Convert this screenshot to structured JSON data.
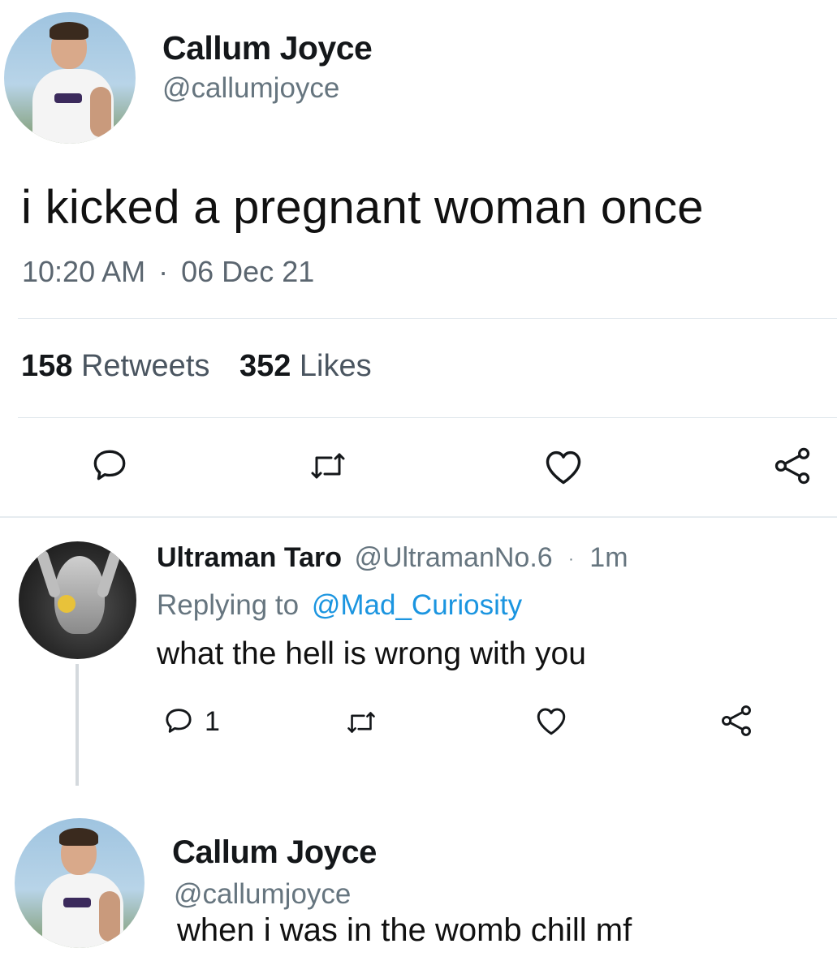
{
  "tweet": {
    "name": "Callum Joyce",
    "handle": "@callumjoyce",
    "text": "i kicked a pregnant woman once",
    "time": "10:20 AM",
    "separator": "·",
    "date": "06 Dec 21",
    "retweets_count": "158",
    "retweets_label": "Retweets",
    "likes_count": "352",
    "likes_label": "Likes"
  },
  "reply1": {
    "name": "Ultraman Taro",
    "handle": "@UltramanNo.6",
    "separator": "·",
    "age": "1m",
    "replying_label": "Replying to",
    "replying_to": "@Mad_Curiosity",
    "text": "what the hell is wrong with you",
    "reply_count": "1"
  },
  "reply2": {
    "name": "Callum Joyce",
    "handle": "@callumjoyce",
    "text": "when i was in the womb chill mf"
  },
  "colors": {
    "link": "#1b95e0",
    "text": "#14171a",
    "muted": "#66757f",
    "divider": "#e1e8ed"
  },
  "icons": [
    "reply-icon",
    "retweet-icon",
    "like-icon",
    "share-icon"
  ]
}
